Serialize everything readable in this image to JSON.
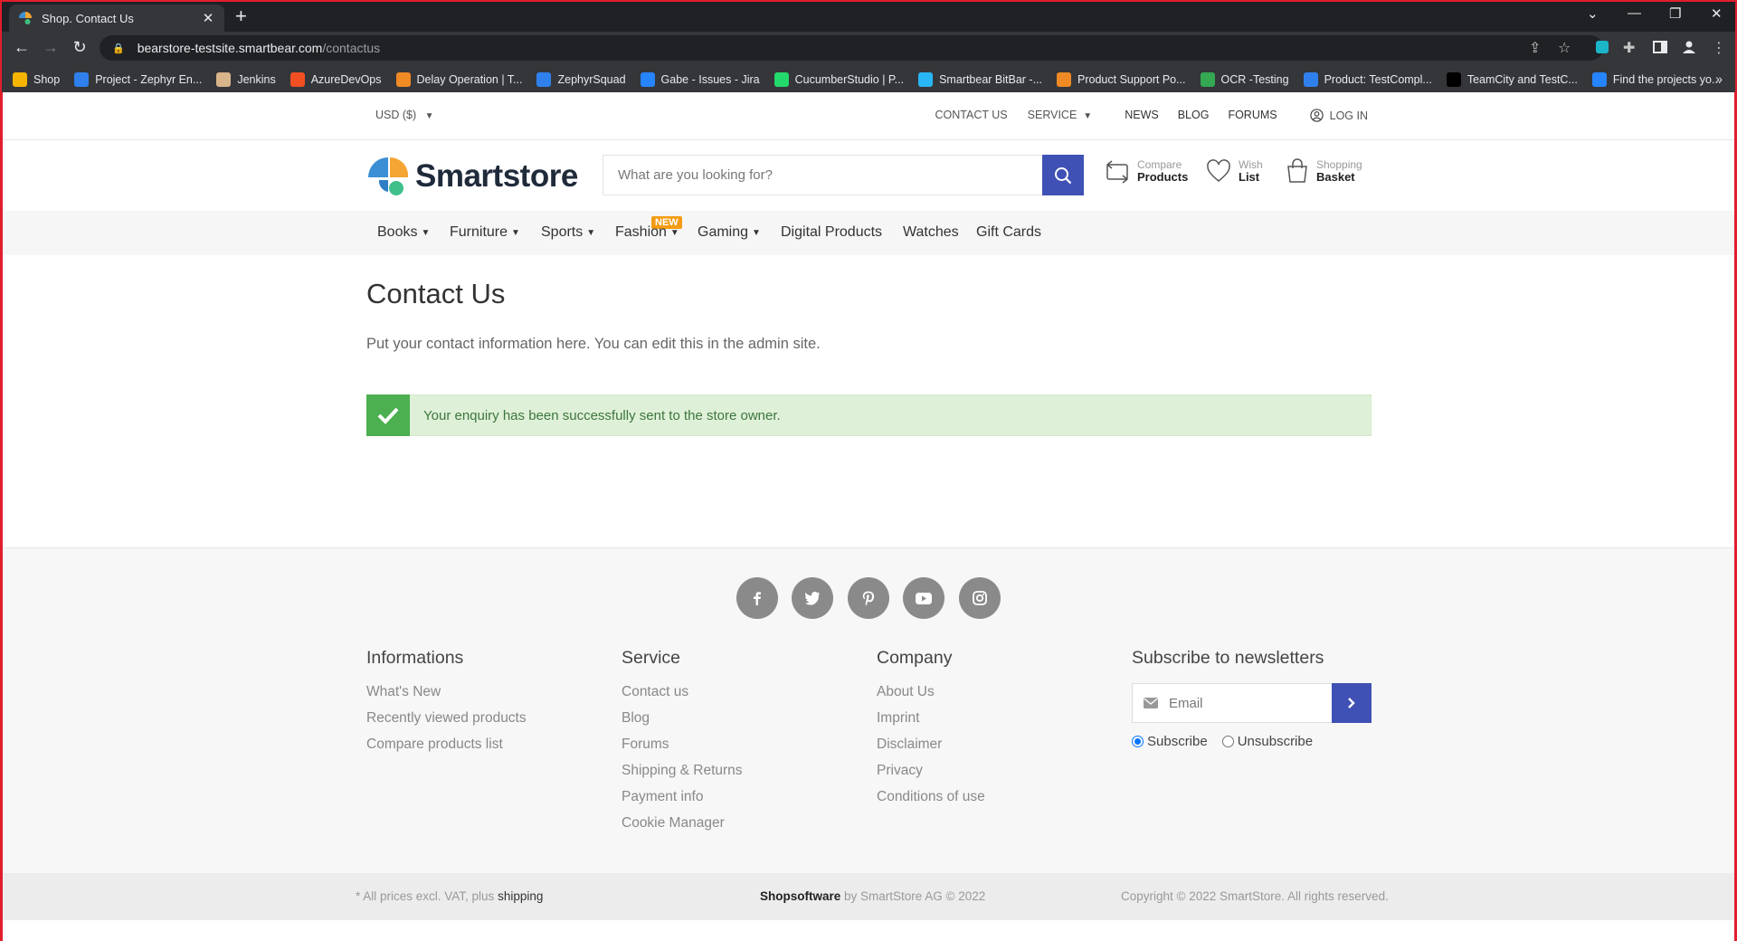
{
  "browser": {
    "tab_title": "Shop. Contact Us",
    "url_host": "bearstore-testsite.smartbear.com",
    "url_path": "/contactus",
    "bookmarks": [
      {
        "label": "Shop",
        "color": "#f4b400"
      },
      {
        "label": "Project - Zephyr En...",
        "color": "#2f80ed"
      },
      {
        "label": "Jenkins",
        "color": "#d8b48a"
      },
      {
        "label": "AzureDevOps",
        "color": "#f25022"
      },
      {
        "label": "Delay Operation | T...",
        "color": "#f08a24"
      },
      {
        "label": "ZephyrSquad",
        "color": "#2f80ed"
      },
      {
        "label": "Gabe - Issues - Jira",
        "color": "#2684ff"
      },
      {
        "label": "CucumberStudio | P...",
        "color": "#23d96c"
      },
      {
        "label": "Smartbear BitBar -...",
        "color": "#29b6f6"
      },
      {
        "label": "Product Support Po...",
        "color": "#f08a24"
      },
      {
        "label": "OCR -Testing",
        "color": "#34a853"
      },
      {
        "label": "Product: TestCompl...",
        "color": "#2f80ed"
      },
      {
        "label": "TeamCity and TestC...",
        "color": "#000000"
      },
      {
        "label": "Find the projects yo...",
        "color": "#2684ff"
      }
    ]
  },
  "topbar": {
    "currency": "USD  ($)",
    "contact_us": "CONTACT US",
    "service": "SERVICE",
    "news": "NEWS",
    "blog": "BLOG",
    "forums": "FORUMS",
    "login": "LOG IN"
  },
  "header": {
    "logo_text": "Smartstore",
    "search_placeholder": "What are you looking for?",
    "compare_top": "Compare",
    "compare_bottom": "Products",
    "wish_top": "Wish",
    "wish_bottom": "List",
    "basket_top": "Shopping",
    "basket_bottom": "Basket"
  },
  "nav": {
    "books": "Books",
    "furniture": "Furniture",
    "sports": "Sports",
    "fashion": "Fashion",
    "fashion_badge": "NEW",
    "gaming": "Gaming",
    "digital": "Digital Products",
    "watches": "Watches",
    "giftcards": "Gift Cards"
  },
  "main": {
    "title": "Contact Us",
    "description": "Put your contact information here. You can edit this in the admin site.",
    "alert": "Your enquiry has been successfully sent to the store owner."
  },
  "footer": {
    "social": [
      "facebook-icon",
      "twitter-icon",
      "pinterest-icon",
      "youtube-icon",
      "instagram-icon"
    ],
    "informations": {
      "title": "Informations",
      "links": [
        "What's New",
        "Recently viewed products",
        "Compare products list"
      ]
    },
    "service": {
      "title": "Service",
      "links": [
        "Contact us",
        "Blog",
        "Forums",
        "Shipping & Returns",
        "Payment info",
        "Cookie Manager"
      ]
    },
    "company": {
      "title": "Company",
      "links": [
        "About Us",
        "Imprint",
        "Disclaimer",
        "Privacy",
        "Conditions of use"
      ]
    },
    "newsletter": {
      "title": "Subscribe to newsletters",
      "email_placeholder": "Email",
      "subscribe": "Subscribe",
      "unsubscribe": "Unsubscribe"
    },
    "bottom": {
      "prices_prefix": "* All prices excl. VAT, plus ",
      "shipping": "shipping",
      "brand": "Shopsoftware",
      "brand_suffix": " by SmartStore AG © 2022",
      "copyright": "Copyright © 2022 SmartStore. All rights reserved."
    }
  },
  "colors": {
    "accent": "#3f51b5",
    "success": "#4caf50",
    "success_bg": "#dff0d8",
    "badge": "#f39c12"
  }
}
